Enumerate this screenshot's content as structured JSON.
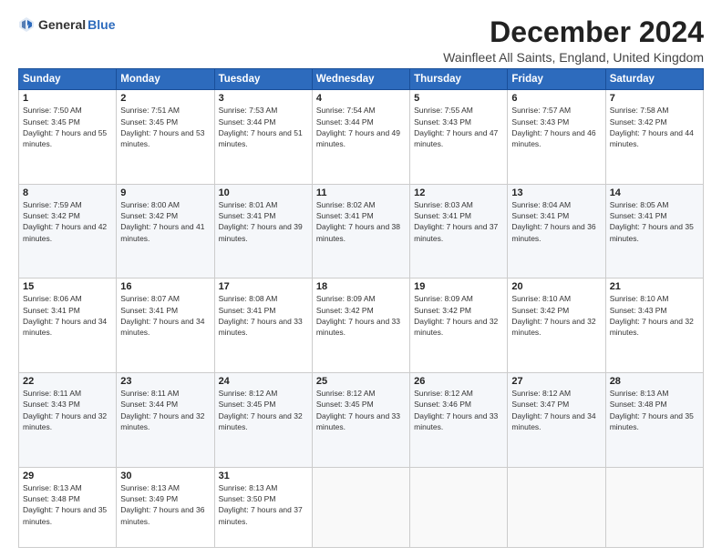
{
  "logo": {
    "general": "General",
    "blue": "Blue"
  },
  "title": "December 2024",
  "subtitle": "Wainfleet All Saints, England, United Kingdom",
  "headers": [
    "Sunday",
    "Monday",
    "Tuesday",
    "Wednesday",
    "Thursday",
    "Friday",
    "Saturday"
  ],
  "weeks": [
    [
      {
        "day": "1",
        "sunrise": "7:50 AM",
        "sunset": "3:45 PM",
        "daylight": "7 hours and 55 minutes."
      },
      {
        "day": "2",
        "sunrise": "7:51 AM",
        "sunset": "3:45 PM",
        "daylight": "7 hours and 53 minutes."
      },
      {
        "day": "3",
        "sunrise": "7:53 AM",
        "sunset": "3:44 PM",
        "daylight": "7 hours and 51 minutes."
      },
      {
        "day": "4",
        "sunrise": "7:54 AM",
        "sunset": "3:44 PM",
        "daylight": "7 hours and 49 minutes."
      },
      {
        "day": "5",
        "sunrise": "7:55 AM",
        "sunset": "3:43 PM",
        "daylight": "7 hours and 47 minutes."
      },
      {
        "day": "6",
        "sunrise": "7:57 AM",
        "sunset": "3:43 PM",
        "daylight": "7 hours and 46 minutes."
      },
      {
        "day": "7",
        "sunrise": "7:58 AM",
        "sunset": "3:42 PM",
        "daylight": "7 hours and 44 minutes."
      }
    ],
    [
      {
        "day": "8",
        "sunrise": "7:59 AM",
        "sunset": "3:42 PM",
        "daylight": "7 hours and 42 minutes."
      },
      {
        "day": "9",
        "sunrise": "8:00 AM",
        "sunset": "3:42 PM",
        "daylight": "7 hours and 41 minutes."
      },
      {
        "day": "10",
        "sunrise": "8:01 AM",
        "sunset": "3:41 PM",
        "daylight": "7 hours and 39 minutes."
      },
      {
        "day": "11",
        "sunrise": "8:02 AM",
        "sunset": "3:41 PM",
        "daylight": "7 hours and 38 minutes."
      },
      {
        "day": "12",
        "sunrise": "8:03 AM",
        "sunset": "3:41 PM",
        "daylight": "7 hours and 37 minutes."
      },
      {
        "day": "13",
        "sunrise": "8:04 AM",
        "sunset": "3:41 PM",
        "daylight": "7 hours and 36 minutes."
      },
      {
        "day": "14",
        "sunrise": "8:05 AM",
        "sunset": "3:41 PM",
        "daylight": "7 hours and 35 minutes."
      }
    ],
    [
      {
        "day": "15",
        "sunrise": "8:06 AM",
        "sunset": "3:41 PM",
        "daylight": "7 hours and 34 minutes."
      },
      {
        "day": "16",
        "sunrise": "8:07 AM",
        "sunset": "3:41 PM",
        "daylight": "7 hours and 34 minutes."
      },
      {
        "day": "17",
        "sunrise": "8:08 AM",
        "sunset": "3:41 PM",
        "daylight": "7 hours and 33 minutes."
      },
      {
        "day": "18",
        "sunrise": "8:09 AM",
        "sunset": "3:42 PM",
        "daylight": "7 hours and 33 minutes."
      },
      {
        "day": "19",
        "sunrise": "8:09 AM",
        "sunset": "3:42 PM",
        "daylight": "7 hours and 32 minutes."
      },
      {
        "day": "20",
        "sunrise": "8:10 AM",
        "sunset": "3:42 PM",
        "daylight": "7 hours and 32 minutes."
      },
      {
        "day": "21",
        "sunrise": "8:10 AM",
        "sunset": "3:43 PM",
        "daylight": "7 hours and 32 minutes."
      }
    ],
    [
      {
        "day": "22",
        "sunrise": "8:11 AM",
        "sunset": "3:43 PM",
        "daylight": "7 hours and 32 minutes."
      },
      {
        "day": "23",
        "sunrise": "8:11 AM",
        "sunset": "3:44 PM",
        "daylight": "7 hours and 32 minutes."
      },
      {
        "day": "24",
        "sunrise": "8:12 AM",
        "sunset": "3:45 PM",
        "daylight": "7 hours and 32 minutes."
      },
      {
        "day": "25",
        "sunrise": "8:12 AM",
        "sunset": "3:45 PM",
        "daylight": "7 hours and 33 minutes."
      },
      {
        "day": "26",
        "sunrise": "8:12 AM",
        "sunset": "3:46 PM",
        "daylight": "7 hours and 33 minutes."
      },
      {
        "day": "27",
        "sunrise": "8:12 AM",
        "sunset": "3:47 PM",
        "daylight": "7 hours and 34 minutes."
      },
      {
        "day": "28",
        "sunrise": "8:13 AM",
        "sunset": "3:48 PM",
        "daylight": "7 hours and 35 minutes."
      }
    ],
    [
      {
        "day": "29",
        "sunrise": "8:13 AM",
        "sunset": "3:48 PM",
        "daylight": "7 hours and 35 minutes."
      },
      {
        "day": "30",
        "sunrise": "8:13 AM",
        "sunset": "3:49 PM",
        "daylight": "7 hours and 36 minutes."
      },
      {
        "day": "31",
        "sunrise": "8:13 AM",
        "sunset": "3:50 PM",
        "daylight": "7 hours and 37 minutes."
      },
      null,
      null,
      null,
      null
    ]
  ]
}
